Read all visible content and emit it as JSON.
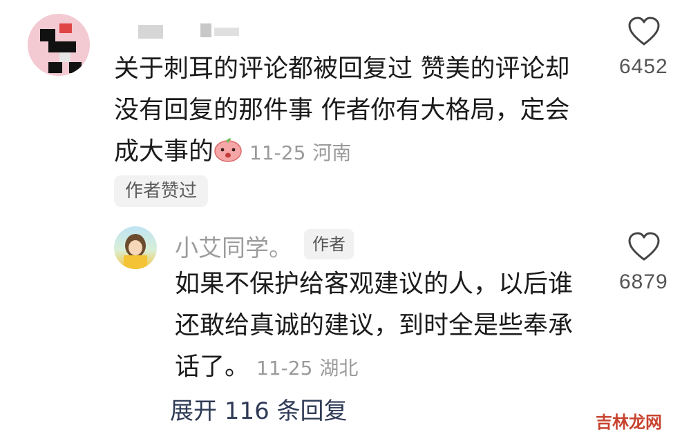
{
  "comment": {
    "lines": [
      "关于刺耳的评论都被回复过 赞美的评论却",
      "没有回复的那件事 作者你有大格局，定会",
      "成大事的"
    ],
    "time": "11-25",
    "location": "河南",
    "liked_badge": "作者赞过",
    "like_count": "6452"
  },
  "reply": {
    "username": "小艾同学。",
    "author_tag": "作者",
    "lines": [
      "如果不保护给客观建议的人，以后谁",
      "还敢给真诚的建议，到时全是些奉承",
      "话了。"
    ],
    "time": "11-25",
    "location": "湖北",
    "like_count": "6879"
  },
  "expand_label": "展开 116 条回复",
  "watermark": "吉林龙网",
  "icons": {
    "like": "heart-outline-icon",
    "emoji": "angry-peach-emoji"
  },
  "colors": {
    "text": "#1b1b1b",
    "meta": "#9a9a9a",
    "expand": "#2f3b56",
    "watermark": "#c8432f"
  }
}
